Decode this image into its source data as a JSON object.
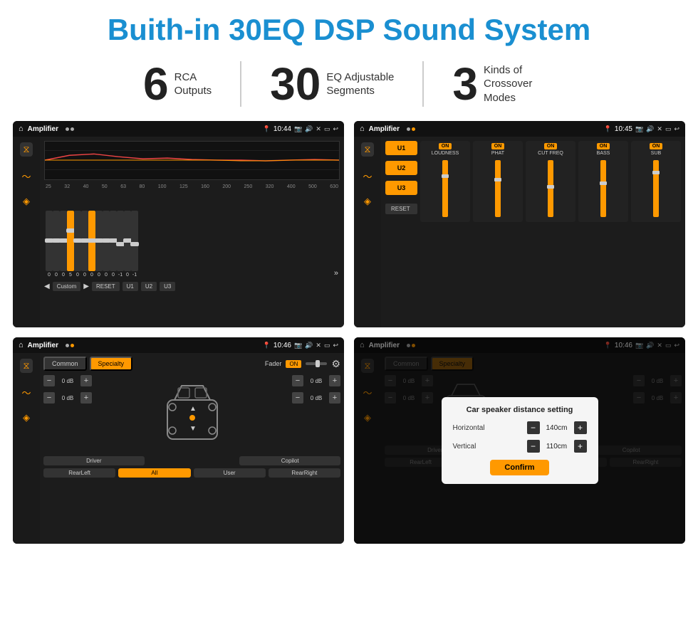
{
  "header": {
    "title": "Buith-in 30EQ DSP Sound System"
  },
  "stats": [
    {
      "number": "6",
      "line1": "RCA",
      "line2": "Outputs"
    },
    {
      "number": "30",
      "line1": "EQ Adjustable",
      "line2": "Segments"
    },
    {
      "number": "3",
      "line1": "Kinds of",
      "line2": "Crossover Modes"
    }
  ],
  "screens": {
    "eq": {
      "topbar_title": "Amplifier",
      "time": "10:44",
      "freq_labels": [
        "25",
        "32",
        "40",
        "50",
        "63",
        "80",
        "100",
        "125",
        "160",
        "200",
        "250",
        "320",
        "400",
        "500",
        "630"
      ],
      "values": [
        "0",
        "0",
        "0",
        "5",
        "0",
        "0",
        "0",
        "0",
        "0",
        "0",
        "-1",
        "0",
        "-1"
      ],
      "bottom_buttons": [
        "Custom",
        "RESET",
        "U1",
        "U2",
        "U3"
      ]
    },
    "crossover": {
      "topbar_title": "Amplifier",
      "time": "10:45",
      "presets": [
        "U1",
        "U2",
        "U3"
      ],
      "channels": [
        "LOUDNESS",
        "PHAT",
        "CUT FREQ",
        "BASS",
        "SUB"
      ],
      "reset_label": "RESET"
    },
    "fader": {
      "topbar_title": "Amplifier",
      "time": "10:46",
      "tabs": [
        "Common",
        "Specialty"
      ],
      "fader_label": "Fader",
      "on_label": "ON",
      "volumes": [
        "0 dB",
        "0 dB",
        "0 dB",
        "0 dB"
      ],
      "buttons": [
        "Driver",
        "",
        "Copilot",
        "RearLeft",
        "All",
        "User",
        "RearRight"
      ]
    },
    "distance": {
      "topbar_title": "Amplifier",
      "time": "10:46",
      "tabs": [
        "Common",
        "Specialty"
      ],
      "dialog": {
        "title": "Car speaker distance setting",
        "horizontal_label": "Horizontal",
        "horizontal_value": "140cm",
        "vertical_label": "Vertical",
        "vertical_value": "110cm",
        "confirm_label": "Confirm"
      },
      "buttons": [
        "Driver",
        "",
        "Copilot",
        "RearLeft",
        "All",
        "User",
        "RearRight"
      ]
    }
  },
  "colors": {
    "accent": "#f90",
    "blue": "#1a8fd1",
    "dark": "#1a1a1a",
    "text": "#ffffff"
  }
}
